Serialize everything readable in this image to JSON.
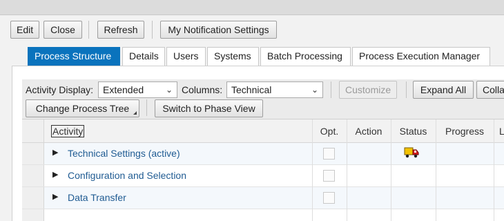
{
  "toolbar": {
    "edit": "Edit",
    "close": "Close",
    "refresh": "Refresh",
    "notification_settings": "My Notification Settings"
  },
  "tabs": [
    {
      "label": "Process Structure",
      "active": true
    },
    {
      "label": "Details",
      "active": false
    },
    {
      "label": "Users",
      "active": false
    },
    {
      "label": "Systems",
      "active": false
    },
    {
      "label": "Batch Processing",
      "active": false
    },
    {
      "label": "Process Execution Manager",
      "active": false
    }
  ],
  "filters": {
    "activity_display_label": "Activity Display:",
    "activity_display_value": "Extended",
    "columns_label": "Columns:",
    "columns_value": "Technical",
    "customize": "Customize",
    "expand_all": "Expand All",
    "collapse_all": "Colla",
    "change_process_tree": "Change Process Tree",
    "switch_phase": "Switch to Phase View"
  },
  "table": {
    "headers": {
      "activity": "Activity",
      "opt": "Opt.",
      "action": "Action",
      "status": "Status",
      "progress": "Progress",
      "last": "L"
    },
    "rows": [
      {
        "activity": "Technical Settings (active)",
        "status_icon": "truck-icon"
      },
      {
        "activity": "Configuration and Selection",
        "status_icon": ""
      },
      {
        "activity": "Data Transfer",
        "status_icon": ""
      }
    ]
  },
  "colors": {
    "active_tab": "#0a73bd",
    "link_text": "#1f5b92"
  }
}
